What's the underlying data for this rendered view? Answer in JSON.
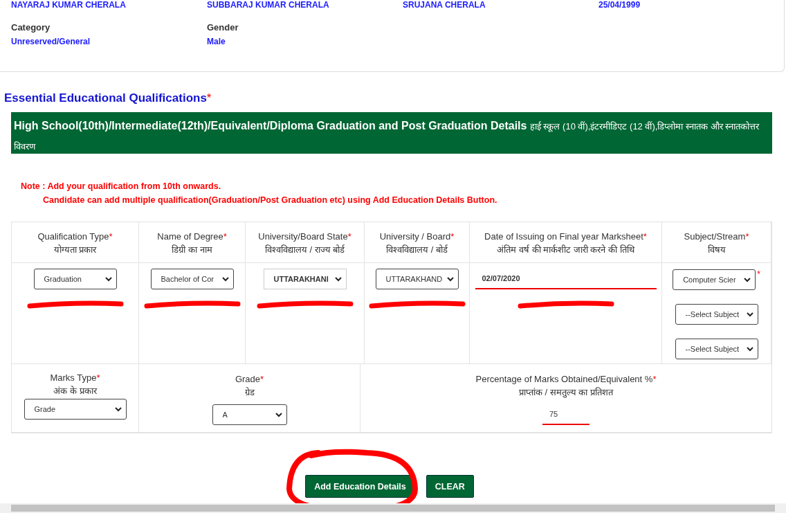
{
  "profile_top": [
    "NAYARAJ KUMAR CHERALA",
    "SUBBARAJ KUMAR CHERALA",
    "SRUJANA CHERALA",
    "25/04/1999"
  ],
  "profile": [
    {
      "label": "Category",
      "value": "Unreserved/General"
    },
    {
      "label": "Gender",
      "value": "Male"
    }
  ],
  "section_title": "Essential Educational Qualifications",
  "required_mark": "*",
  "banner": {
    "title": "High School(10th)/Intermediate(12th)/Equivalent/Diploma Graduation and Post Graduation Details",
    "title_hi": "हाई स्कूल (10 वीं),इंटरमीडिएट (12 वीं),डिप्लोमा स्नातक और स्नातकोत्तर विवरण"
  },
  "note": [
    "Note : Add your qualification from 10th onwards.",
    "Candidate can add multiple qualification(Graduation/Post Graduation etc) using Add Education Details Button."
  ],
  "columns": [
    {
      "label": "Qualification Type",
      "label_hi": "योग्यता प्रकार",
      "fields": [
        {
          "kind": "select",
          "value": "Graduation"
        }
      ]
    },
    {
      "label": "Name of Degree",
      "label_hi": "डिग्री का नाम",
      "fields": [
        {
          "kind": "select",
          "value": "Bachelor of Cor"
        }
      ]
    },
    {
      "label": "University/Board State",
      "label_hi": "विश्वविद्यालय / राज्य बोर्ड",
      "fields": [
        {
          "kind": "select",
          "value": "UTTARAKHANI",
          "bold": true
        }
      ]
    },
    {
      "label": "University / Board",
      "label_hi": "विश्वविद्यालय / बोर्ड",
      "fields": [
        {
          "kind": "select",
          "value": "UTTARAKHAND"
        }
      ]
    },
    {
      "label": "Date of Issuing on Final year Marksheet",
      "label_hi": "अंतिम वर्ष की मार्कशीट जारी करने की तिथि",
      "fields": [
        {
          "kind": "input",
          "value": "02/07/2020"
        }
      ]
    },
    {
      "label": "Subject/Stream",
      "label_hi": "विषय",
      "fields": [
        {
          "kind": "select",
          "value": "Computer Scier",
          "flag": "*"
        },
        {
          "kind": "select",
          "value": "--Select Subject"
        },
        {
          "kind": "select",
          "value": "--Select Subject"
        }
      ]
    }
  ],
  "marks": [
    {
      "label": "Marks Type",
      "label_hi": "अंक के प्रकार",
      "field": {
        "kind": "select",
        "value": "Grade"
      }
    },
    {
      "label": "Grade",
      "label_hi": "ग्रेड",
      "field": {
        "kind": "select",
        "value": "A"
      }
    },
    {
      "label": "Percentage of Marks Obtained/Equivalent %",
      "label_hi": "प्राप्तांक / समतुल्य का प्रतिशत",
      "field": {
        "kind": "input",
        "value": "75"
      }
    }
  ],
  "buttons": [
    "Add Education Details",
    "CLEAR"
  ]
}
